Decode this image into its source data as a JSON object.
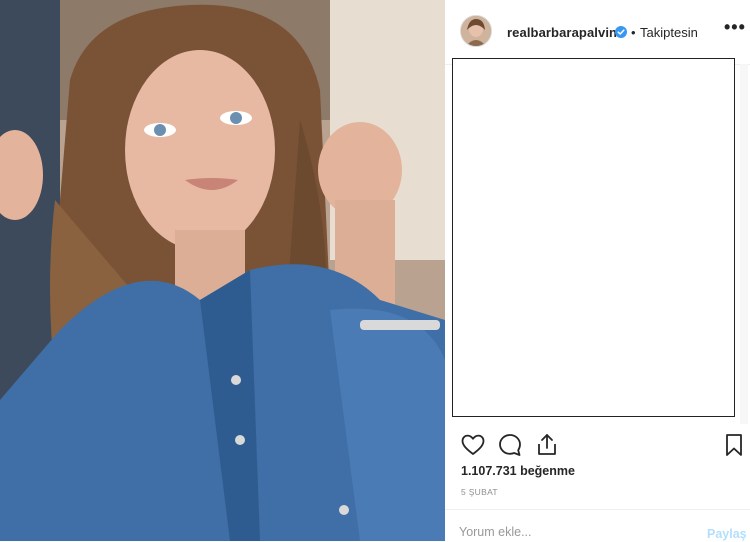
{
  "post": {
    "username": "realbarbarapalvin",
    "verified": true,
    "separator": "•",
    "follow_status": "Takiptesin",
    "more_icon": "more-options-icon",
    "likes_text": "1.107.731 beğenme",
    "date_text": "5 ŞUBAT"
  },
  "comment": {
    "placeholder": "Yorum ekle...",
    "post_label": "Paylaş"
  },
  "icons": {
    "like": "heart-icon",
    "comment": "comment-icon",
    "share": "share-icon",
    "save": "bookmark-icon",
    "verified": "verified-badge-icon"
  },
  "colors": {
    "verified_blue": "#3897f0",
    "post_button_disabled": "#b2dffc",
    "text": "#262626",
    "muted": "#8e8e8e"
  }
}
